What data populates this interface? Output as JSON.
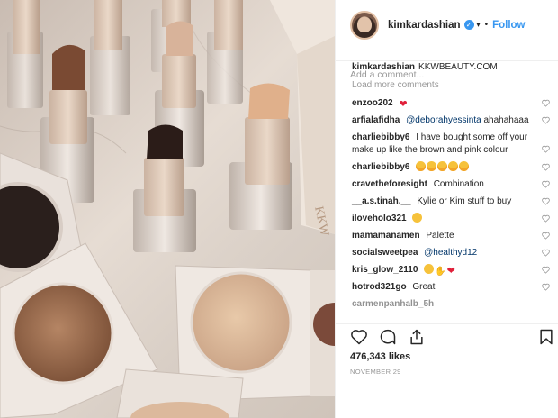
{
  "header": {
    "username": "kimkardashian",
    "verified_glyph": "✓",
    "separator": "•",
    "follow_label": "Follow"
  },
  "caption": {
    "username": "kimkardashian",
    "text": "KKWBEAUTY.COM"
  },
  "load_more": "Load more comments",
  "comments": [
    {
      "user": "enzoo202",
      "text": "",
      "emoji": [
        "heart"
      ]
    },
    {
      "user": "arfialafidha",
      "text": "@deborahyessinta ahahahaaa",
      "mention": "@deborahyessinta",
      "rest": "ahahahaaa"
    },
    {
      "user": "charliebibby6",
      "text": "I have bought some off your make up like the brown and pink colour"
    },
    {
      "user": "charliebibby6",
      "text": "",
      "emoji": [
        "laugh",
        "laugh",
        "laugh",
        "laugh",
        "laugh"
      ]
    },
    {
      "user": "cravetheforesight",
      "text": "Combination"
    },
    {
      "user": "__a.s.tinah.__",
      "text": "Kylie or Kim stuff to buy"
    },
    {
      "user": "iloveholo321",
      "text": "",
      "emoji": [
        "glasses"
      ]
    },
    {
      "user": "mamamanamen",
      "text": "Palette"
    },
    {
      "user": "socialsweetpea",
      "text": "@healthyd12",
      "mention": "@healthyd12"
    },
    {
      "user": "kris_glow_2110",
      "text": "",
      "emoji": [
        "hearteyes",
        "clap",
        "heart"
      ]
    },
    {
      "user": "hotrod321go",
      "text": "Great"
    },
    {
      "user": "carmenpanhalb_5h",
      "text": ""
    }
  ],
  "icons": {
    "like": "heart-outline-icon",
    "comment": "comment-bubble-icon",
    "share": "share-icon",
    "save": "bookmark-icon"
  },
  "likes": "476,343 likes",
  "date": "NOVEMBER 29",
  "add_comment_placeholder": "Add a comment...",
  "photo_text": "KKW"
}
